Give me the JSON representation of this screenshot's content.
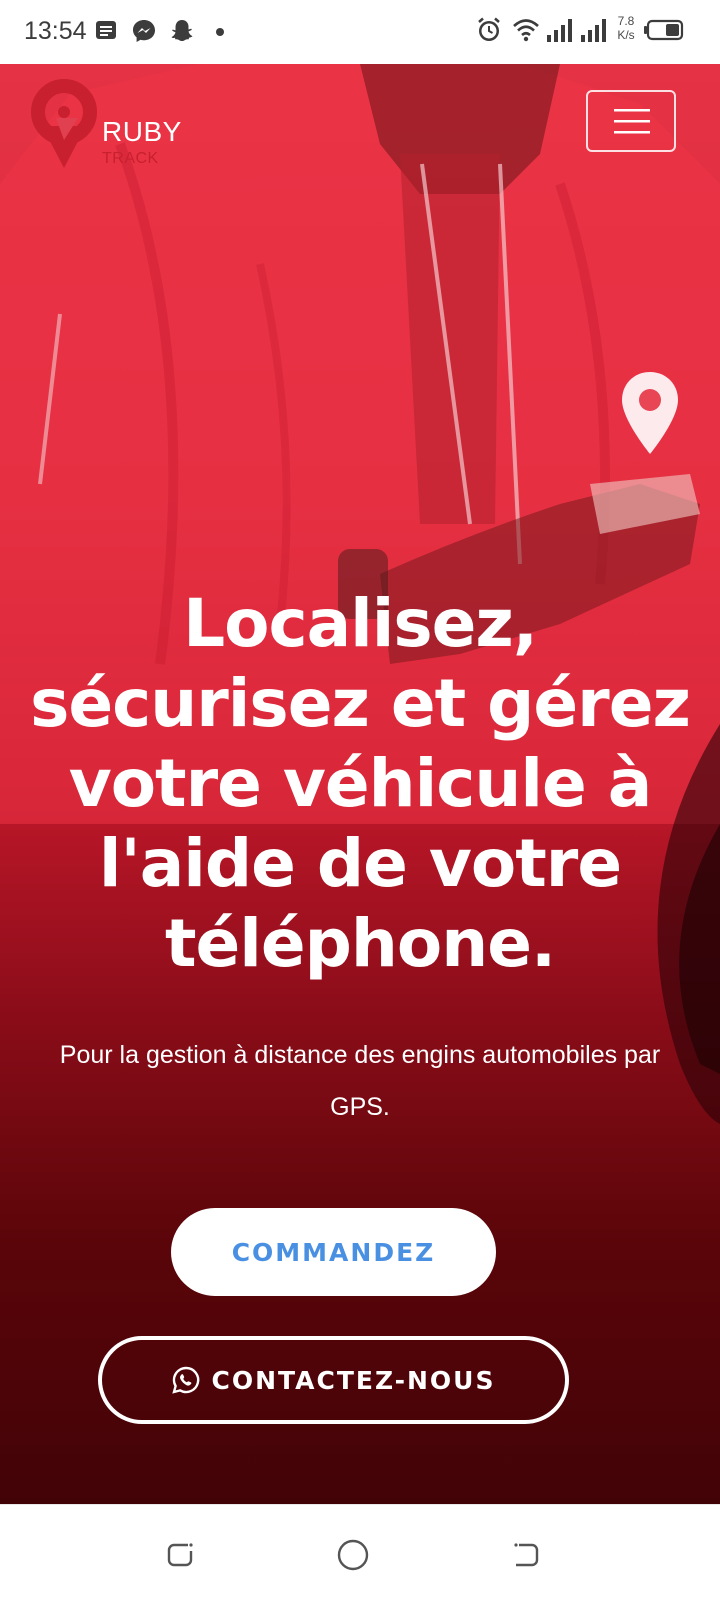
{
  "status_bar": {
    "time": "13:54",
    "network_speed_value": "7.8",
    "network_speed_unit": "K/s",
    "icons": [
      "notes-icon",
      "messenger-icon",
      "snapchat-icon",
      "dot-icon",
      "alarm-icon",
      "wifi-icon",
      "signal-icon",
      "signal-icon",
      "battery-icon"
    ]
  },
  "brand": {
    "name_line1": "RUBY",
    "name_line2": "TRACK",
    "primary_color": "#c8202e",
    "accent_color": "#4a90e2"
  },
  "header": {
    "menu_icon": "hamburger-icon"
  },
  "hero": {
    "headline": "Localisez, sécurisez et gérez votre véhicule à l'aide de votre téléphone.",
    "subtitle": "Pour la gestion à distance des engins automobiles par GPS.",
    "primary_button": "COMMANDEZ",
    "secondary_button": "CONTACTEZ-NOUS",
    "secondary_button_icon": "whatsapp-icon",
    "decor_icon": "location-pin-icon"
  },
  "nav_bar": {
    "buttons": [
      "recents-icon",
      "home-icon",
      "back-icon"
    ]
  }
}
